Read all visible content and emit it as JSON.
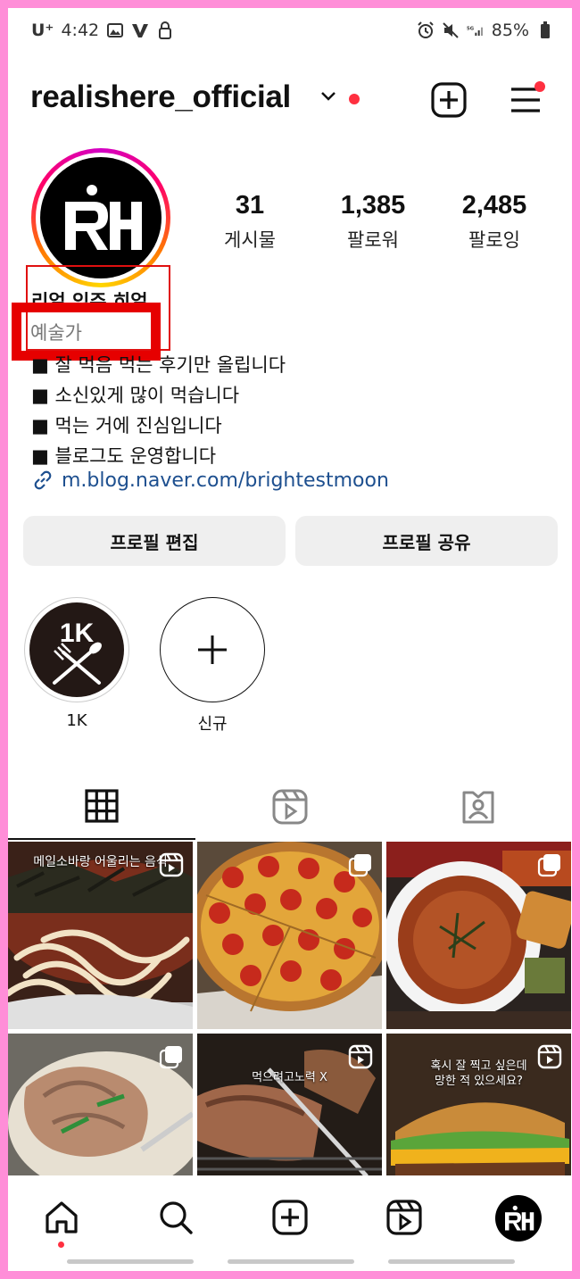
{
  "status_bar": {
    "carrier": "U⁺",
    "time": "4:42",
    "battery": "85%"
  },
  "header": {
    "username": "realishere_official",
    "icons": [
      "chevron-down-icon",
      "new-post-icon",
      "menu-icon"
    ]
  },
  "profile": {
    "avatar_text": "RH",
    "stats": [
      {
        "value": "31",
        "label": "게시물"
      },
      {
        "value": "1,385",
        "label": "팔로워"
      },
      {
        "value": "2,485",
        "label": "팔로잉"
      }
    ],
    "name": "리얼 있주 히얼",
    "category": "예술가",
    "bio": [
      "■ 잘 먹음 먹는 후기만 올립니다",
      "■ 소신있게 많이 먹습니다",
      "■ 먹는 거에 진심입니다",
      "■ 블로그도 운영합니다"
    ],
    "link": "m.blog.naver.com/brightestmoon"
  },
  "buttons": {
    "edit_profile": "프로필 편집",
    "share_profile": "프로필 공유"
  },
  "highlights": [
    {
      "label": "1K",
      "badge_text": "1K"
    },
    {
      "label": "신규"
    }
  ],
  "tabs": [
    "grid-icon",
    "reels-icon",
    "tagged-icon"
  ],
  "posts": [
    {
      "caption": "메일소바랑 어울리는 음식",
      "type": "reel"
    },
    {
      "caption": "",
      "type": "carousel"
    },
    {
      "caption": "",
      "type": "carousel"
    },
    {
      "caption": "",
      "type": "carousel"
    },
    {
      "caption": "먹으려고노력 X",
      "type": "reel"
    },
    {
      "caption": "혹시 잘 찍고 싶은데\n망한 적 있으세요?",
      "type": "reel"
    }
  ],
  "bottom_nav": [
    "home-icon",
    "search-icon",
    "create-icon",
    "reels-icon",
    "profile-avatar"
  ],
  "colors": {
    "accent_red": "#ff3040",
    "link_blue": "#1d4f8f",
    "highlight_box": "#e60000",
    "frame_pink": "#ff8ed8"
  }
}
